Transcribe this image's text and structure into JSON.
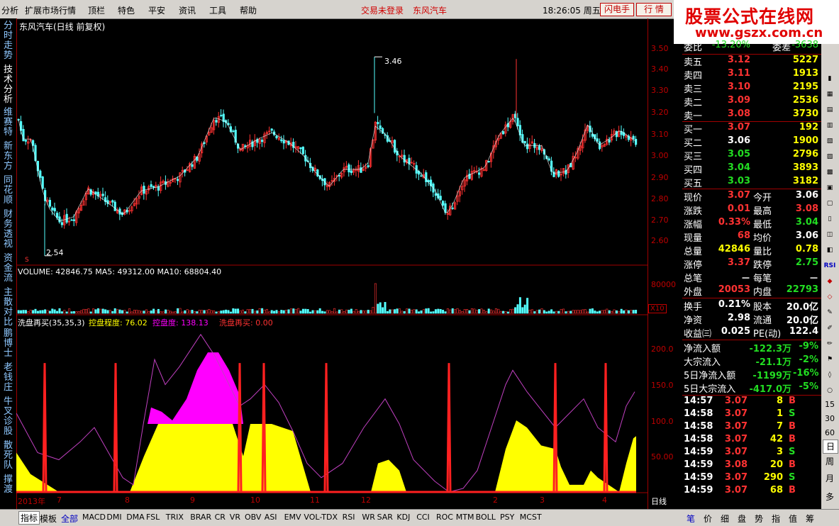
{
  "menu": {
    "items": [
      "分析",
      "扩展市场行情",
      "顶栏",
      "特色",
      "平安",
      "资讯",
      "工具",
      "帮助"
    ],
    "status1": "交易未登录",
    "status2": "东风汽车",
    "time": "18:26:05 周五",
    "btn1": "闪电手",
    "btn2": "行 情"
  },
  "logo": {
    "line1": "股票公式在线网",
    "line2": "www.gszx.com.cn",
    "color": "#e00000"
  },
  "left_tabs": [
    "分时走势",
    "技术分析",
    "维赛特",
    "新东方",
    "同花顺",
    "财务透视",
    "资金流",
    "主散对比",
    "鹏博士",
    "老钱庄",
    "牛叉诊股",
    "散死队",
    "撑渡"
  ],
  "chart": {
    "title": "东风汽车(日线 前复权)",
    "high_label": "3.46",
    "low_label": "2.54",
    "s_mark": "S",
    "volume_label": "VOLUME: 42846.75  MA5: 49312.00  MA10: 68804.40",
    "volume_axis": "80000",
    "x10": "X10",
    "ind_name": "洗盘再买(35,35,3)",
    "ind_a": "控盘程度: 76.02",
    "ind_b": "控盘度: 138.13",
    "ind_c": "洗盘再买: 0.00",
    "price_axis": [
      "3.50",
      "3.40",
      "3.30",
      "3.20",
      "3.10",
      "3.00",
      "2.90",
      "2.80",
      "2.70",
      "2.60"
    ],
    "ind_axis": [
      "200.0",
      "150.0",
      "100.0",
      "50.00"
    ],
    "date_labels": [
      "2013年",
      "7",
      "8",
      "9",
      "10",
      "11",
      "12",
      "2",
      "3",
      "4"
    ],
    "period": "日线",
    "colors": {
      "up": "#ff3232",
      "down": "#54ffff",
      "ma": "#ffffff",
      "yellow": "#ffff00",
      "magenta": "#ff00ff",
      "line": "#c040c0"
    }
  },
  "quote": {
    "header": [
      [
        "委比",
        "-13.20%",
        "委差",
        "-3638"
      ]
    ],
    "sell": [
      [
        "卖五",
        "3.12",
        "5227"
      ],
      [
        "卖四",
        "3.11",
        "1913"
      ],
      [
        "卖三",
        "3.10",
        "2195"
      ],
      [
        "卖二",
        "3.09",
        "2536"
      ],
      [
        "卖一",
        "3.08",
        "3730"
      ]
    ],
    "buy": [
      [
        "买一",
        "3.07",
        "192"
      ],
      [
        "买二",
        "3.06",
        "1900"
      ],
      [
        "买三",
        "3.05",
        "2796"
      ],
      [
        "买四",
        "3.04",
        "3893"
      ],
      [
        "买五",
        "3.03",
        "3182"
      ]
    ],
    "stats": [
      [
        "现价",
        "3.07",
        "今开",
        "3.06"
      ],
      [
        "涨跌",
        "0.01",
        "最高",
        "3.08"
      ],
      [
        "涨幅",
        "0.33%",
        "最低",
        "3.04"
      ],
      [
        "现量",
        "68",
        "均价",
        "3.06"
      ],
      [
        "总量",
        "42846",
        "量比",
        "0.78"
      ],
      [
        "涨停",
        "3.37",
        "跌停",
        "2.75"
      ],
      [
        "总笔",
        "－",
        "每笔",
        "－"
      ],
      [
        "外盘",
        "20053",
        "内盘",
        "22793"
      ]
    ],
    "fin": [
      [
        "换手",
        "0.21%",
        "股本",
        "20.0亿"
      ],
      [
        "净资",
        "2.98",
        "流通",
        "20.0亿"
      ],
      [
        "收益㈢",
        "0.025",
        "PE(动)",
        "122.4"
      ]
    ],
    "flow": [
      [
        "净流入额",
        "-122.3万",
        "-9%"
      ],
      [
        "大宗流入",
        "-21.1万",
        "-2%"
      ],
      [
        "5日净流入额",
        "-1199万",
        "-16%"
      ],
      [
        "5日大宗流入",
        "-417.0万",
        "-5%"
      ]
    ],
    "ticks": [
      [
        "14:57",
        "3.07",
        "8",
        "B"
      ],
      [
        "14:58",
        "3.07",
        "1",
        "S"
      ],
      [
        "14:58",
        "3.07",
        "7",
        "B"
      ],
      [
        "14:58",
        "3.07",
        "42",
        "B"
      ],
      [
        "14:59",
        "3.07",
        "3",
        "S"
      ],
      [
        "14:59",
        "3.08",
        "20",
        "B"
      ],
      [
        "14:59",
        "3.07",
        "290",
        "S"
      ],
      [
        "14:59",
        "3.07",
        "68",
        "B"
      ]
    ]
  },
  "right_tools": [
    "RSI",
    "15",
    "30",
    "60",
    "日",
    "周",
    "月",
    "多"
  ],
  "bottom_tabs": [
    "指标",
    "模板",
    "全部",
    "MACD",
    "DMI",
    "DMA",
    "FSL",
    "TRIX",
    "BRAR",
    "CR",
    "VR",
    "OBV",
    "ASI",
    "EMV",
    "VOL-TDX",
    "RSI",
    "WR",
    "SAR",
    "KDJ",
    "CCI",
    "ROC",
    "MTM",
    "BOLL",
    "PSY",
    "MCST"
  ],
  "bottom_right": [
    "笔",
    "价",
    "细",
    "盘",
    "势",
    "指",
    "值",
    "筹"
  ]
}
